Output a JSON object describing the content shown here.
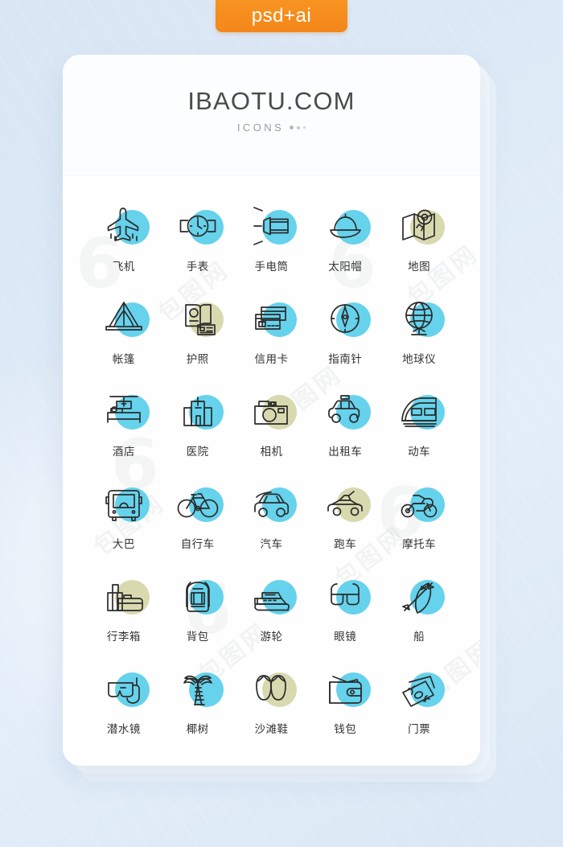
{
  "tag": {
    "label": "psd+ai"
  },
  "card": {
    "brand": "IBAOTU.COM",
    "subtitle": "ICONS"
  },
  "colors": {
    "blue": "#66d2ec",
    "khaki": "#d9d9b0",
    "stroke": "#2b2b2b",
    "accent_orange": "#f5861a",
    "page_bg": "#dde9f6",
    "card_bg": "#fefefe",
    "label_text": "#333333"
  },
  "watermarks": {
    "text": "包图网",
    "logo": "6"
  },
  "icons": [
    {
      "name": "airplane",
      "label": "飞机",
      "blob": "blue"
    },
    {
      "name": "watch",
      "label": "手表",
      "blob": "blue"
    },
    {
      "name": "flashlight",
      "label": "手电筒",
      "blob": "blue"
    },
    {
      "name": "sun-hat",
      "label": "太阳帽",
      "blob": "blue"
    },
    {
      "name": "map",
      "label": "地图",
      "blob": "khaki"
    },
    {
      "name": "tent",
      "label": "帐篷",
      "blob": "blue"
    },
    {
      "name": "passport",
      "label": "护照",
      "blob": "khaki"
    },
    {
      "name": "credit-card",
      "label": "信用卡",
      "blob": "blue"
    },
    {
      "name": "compass",
      "label": "指南针",
      "blob": "blue"
    },
    {
      "name": "globe",
      "label": "地球仪",
      "blob": "blue"
    },
    {
      "name": "hotel",
      "label": "酒店",
      "blob": "blue"
    },
    {
      "name": "hospital",
      "label": "医院",
      "blob": "blue"
    },
    {
      "name": "camera",
      "label": "相机",
      "blob": "khaki"
    },
    {
      "name": "taxi",
      "label": "出租车",
      "blob": "blue"
    },
    {
      "name": "bullet-train",
      "label": "动车",
      "blob": "blue"
    },
    {
      "name": "bus",
      "label": "大巴",
      "blob": "blue"
    },
    {
      "name": "bicycle",
      "label": "自行车",
      "blob": "blue"
    },
    {
      "name": "car",
      "label": "汽车",
      "blob": "blue"
    },
    {
      "name": "sports-car",
      "label": "跑车",
      "blob": "khaki"
    },
    {
      "name": "motorcycle",
      "label": "摩托车",
      "blob": "blue"
    },
    {
      "name": "suitcase",
      "label": "行李箱",
      "blob": "khaki"
    },
    {
      "name": "backpack",
      "label": "背包",
      "blob": "blue"
    },
    {
      "name": "cruise-ship",
      "label": "游轮",
      "blob": "blue"
    },
    {
      "name": "glasses",
      "label": "眼镜",
      "blob": "blue"
    },
    {
      "name": "kayak",
      "label": "船",
      "blob": "blue"
    },
    {
      "name": "diving-mask",
      "label": "潜水镜",
      "blob": "blue"
    },
    {
      "name": "palm-tree",
      "label": "椰树",
      "blob": "blue"
    },
    {
      "name": "flip-flops",
      "label": "沙滩鞋",
      "blob": "khaki"
    },
    {
      "name": "wallet",
      "label": "钱包",
      "blob": "blue"
    },
    {
      "name": "ticket",
      "label": "门票",
      "blob": "blue"
    }
  ]
}
